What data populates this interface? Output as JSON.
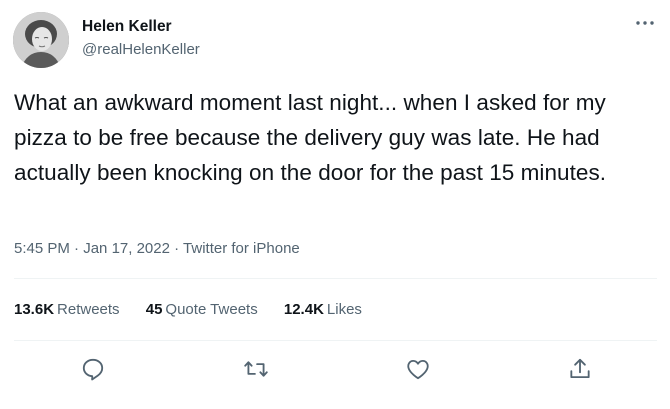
{
  "user": {
    "display_name": "Helen Keller",
    "handle": "@realHelenKeller",
    "avatar_icon": "portrait-avatar"
  },
  "tweet": {
    "text": "What an awkward moment last night... when I asked for my pizza to be free because the delivery guy was late. He had actually been knocking on the door for the past 15 minutes."
  },
  "meta": {
    "time": "5:45 PM",
    "separator": "·",
    "date": "Jan 17, 2022",
    "source": "Twitter for iPhone"
  },
  "stats": {
    "retweets_count": "13.6K",
    "retweets_label": "Retweets",
    "quotes_count": "45",
    "quotes_label": "Quote Tweets",
    "likes_count": "12.4K",
    "likes_label": "Likes"
  },
  "icons": {
    "more": "more-horizontal-icon",
    "reply": "reply-icon",
    "retweet": "retweet-icon",
    "like": "heart-icon",
    "share": "share-icon"
  },
  "colors": {
    "text_primary": "#0f1419",
    "text_secondary": "#536471",
    "divider": "#eff3f4"
  }
}
